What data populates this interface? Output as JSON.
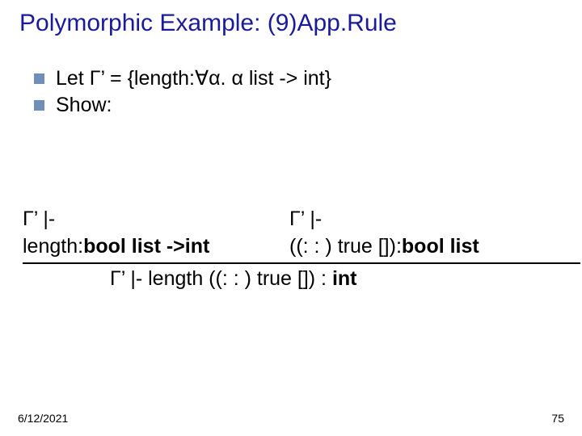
{
  "title": "Polymorphic Example: (9)App.Rule",
  "bullets": [
    {
      "text": "Let Γ’ = {length:∀α. α list -> int}"
    },
    {
      "text": "Show:"
    }
  ],
  "derivation": {
    "premise_left_line1": "Γ’ |-",
    "premise_left_line2_pre": "length:",
    "premise_left_line2_bold": "bool list ->int",
    "premise_right_line1": "Γ’ |-",
    "premise_right_line2_pre": "((: : ) true []):",
    "premise_right_line2_bold": "bool list",
    "conclusion_pre": "Γ’ |- length ((: : ) true []) :",
    "conclusion_bold": " int"
  },
  "footer": {
    "date": "6/12/2021",
    "page": "75"
  }
}
